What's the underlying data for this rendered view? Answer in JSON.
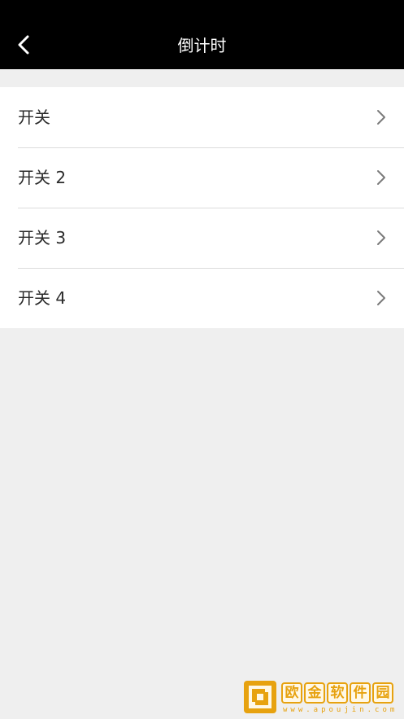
{
  "navbar": {
    "title": "倒计时",
    "background": "#000000"
  },
  "list": {
    "items": [
      {
        "label": "开关"
      },
      {
        "label": "开关 2"
      },
      {
        "label": "开关 3"
      },
      {
        "label": "开关 4"
      }
    ]
  },
  "watermark": {
    "chars": [
      "欧",
      "金",
      "软",
      "件",
      "园"
    ],
    "url": "www.apoujin.com",
    "color": "#e7a20f"
  }
}
